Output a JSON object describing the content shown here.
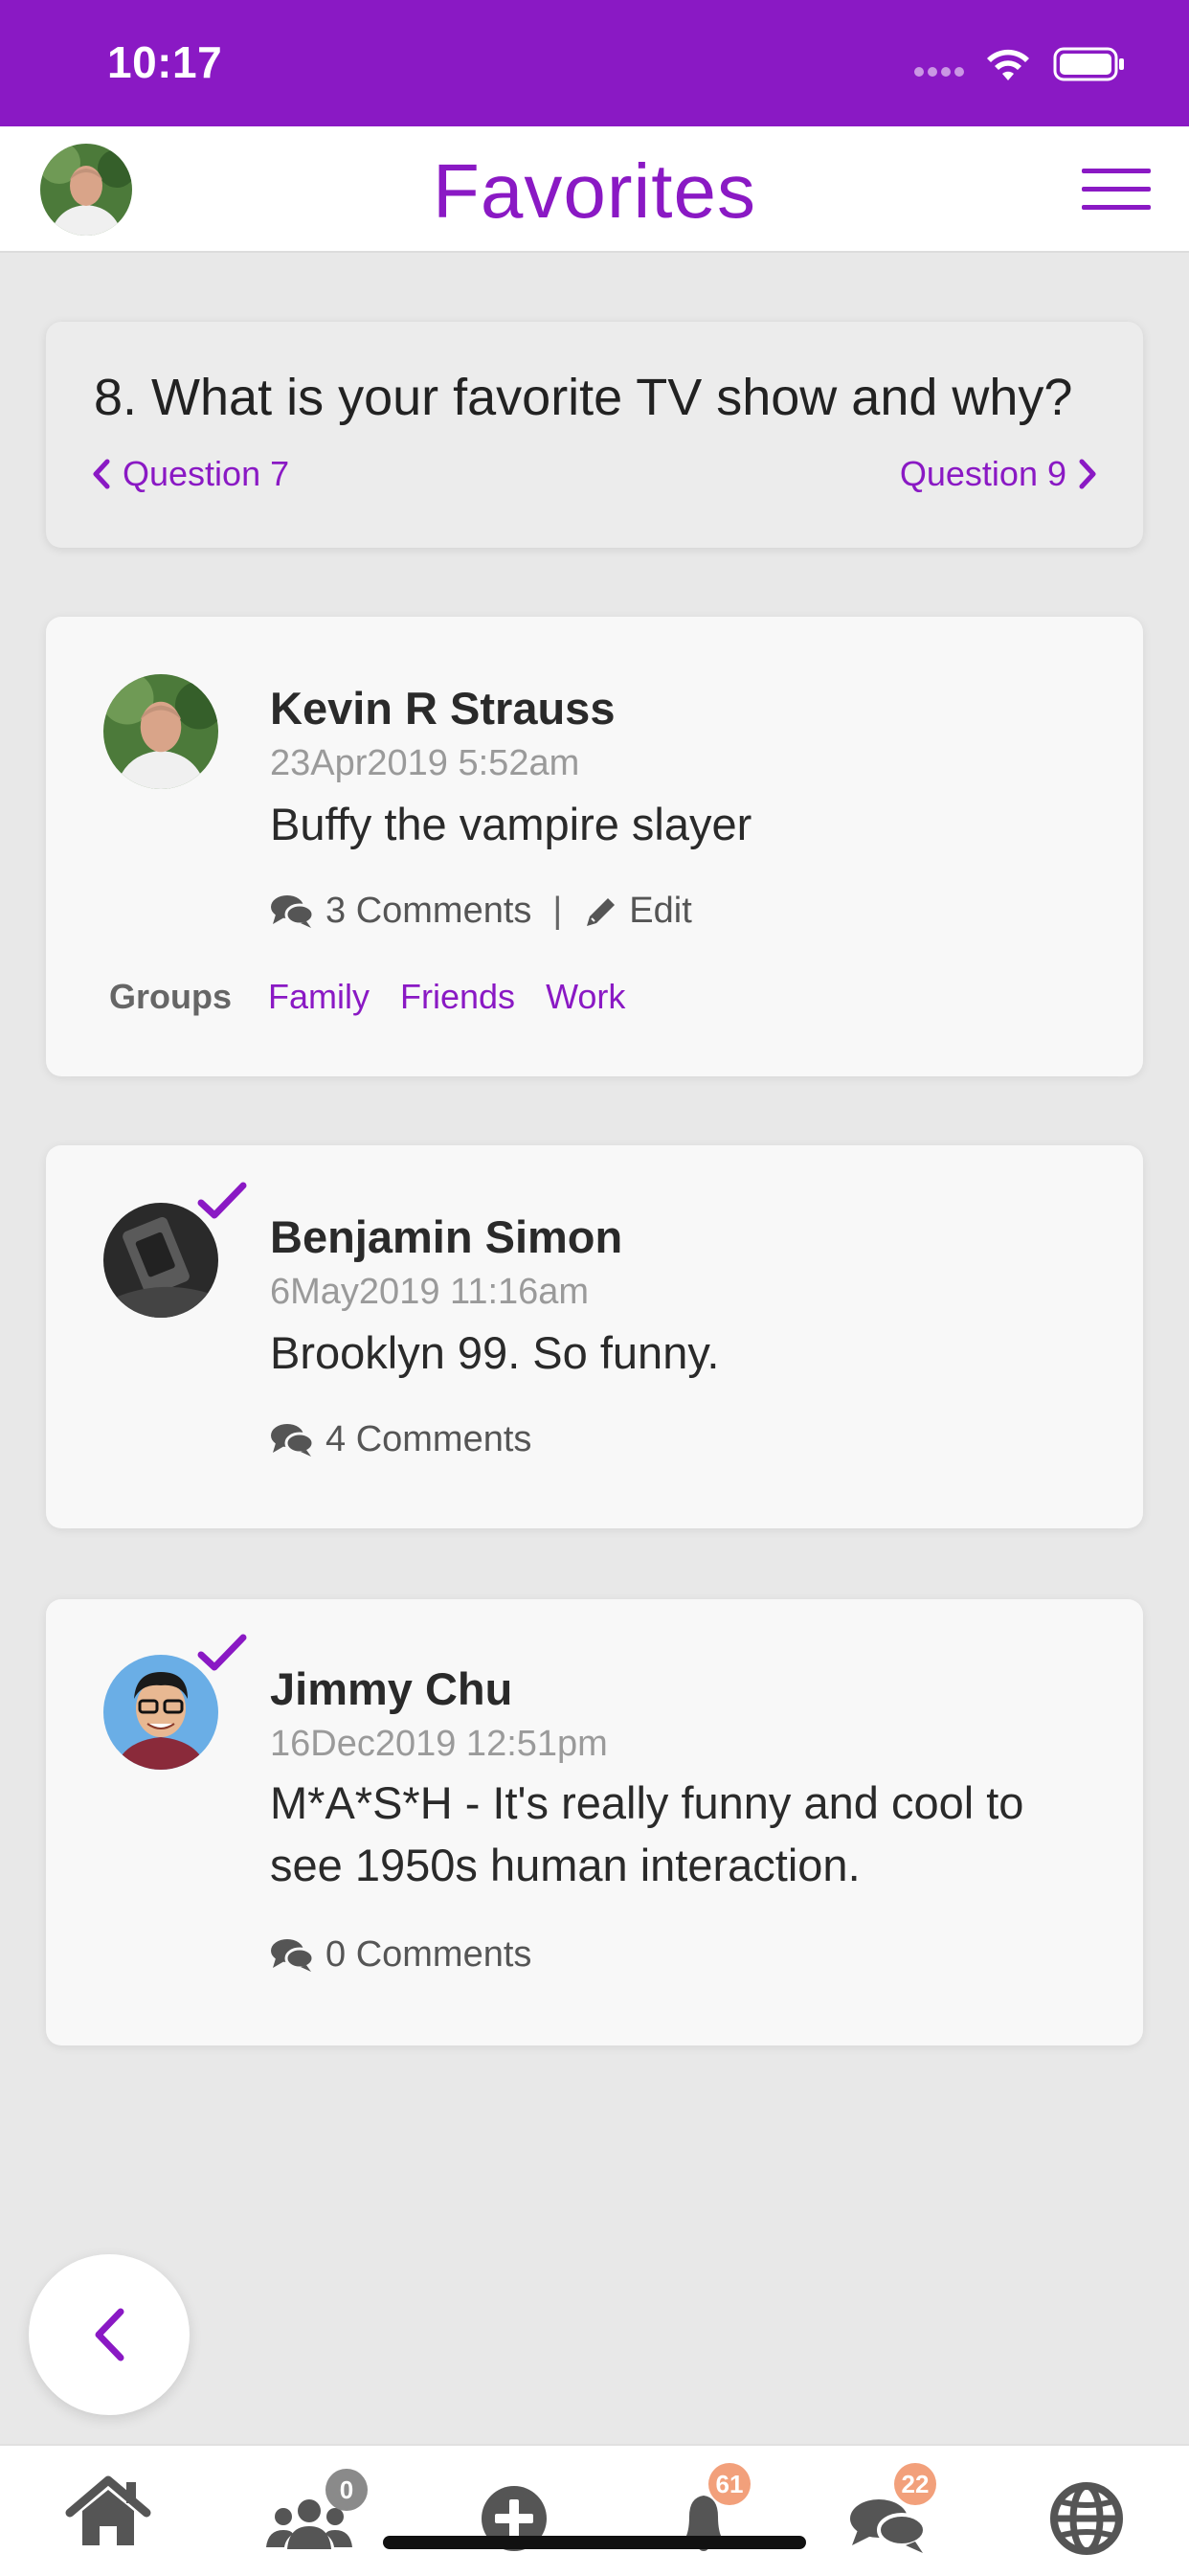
{
  "status": {
    "time": "10:17"
  },
  "header": {
    "title": "Favorites"
  },
  "question": {
    "text": "8. What is your favorite TV show and why?",
    "prev_label": "Question 7",
    "next_label": "Question 9"
  },
  "answers": [
    {
      "author": "Kevin R Strauss",
      "date": "23Apr2019 5:52am",
      "text": "Buffy the vampire slayer",
      "comments": "3 Comments",
      "separator": "|",
      "edit_label": "Edit",
      "groups_label": "Groups",
      "groups": [
        "Family",
        "Friends",
        "Work"
      ]
    },
    {
      "author": "Benjamin Simon",
      "date": "6May2019 11:16am",
      "text": "Brooklyn 99. So funny.",
      "comments": "4 Comments"
    },
    {
      "author": "Jimmy Chu",
      "date": "16Dec2019 12:51pm",
      "text": "M*A*S*H - It's really funny and cool to see 1950s human interaction.",
      "comments": "0 Comments"
    }
  ],
  "tabbar": {
    "items": [
      {
        "icon": "home-icon"
      },
      {
        "icon": "group-icon",
        "badge": "0"
      },
      {
        "icon": "add-circle-icon"
      },
      {
        "icon": "bell-icon",
        "badge": "61"
      },
      {
        "icon": "chat-icon",
        "badge": "22"
      },
      {
        "icon": "globe-icon"
      }
    ]
  },
  "colors": {
    "brand_purple": "#8a19c4",
    "badge_orange": "#f2a07b",
    "badge_gray": "#8a8a8a"
  }
}
